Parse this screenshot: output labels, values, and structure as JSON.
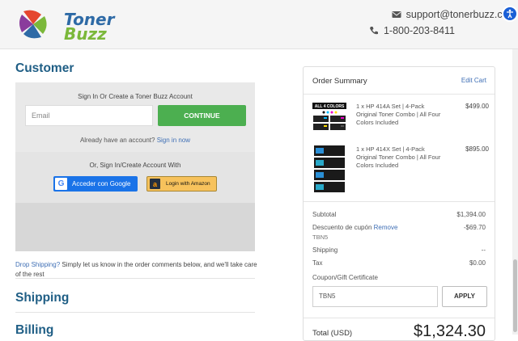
{
  "header": {
    "logo_line1": "Toner",
    "logo_line2": "Buzz",
    "email": "support@tonerbuzz.com",
    "phone": "1-800-203-8411"
  },
  "customer": {
    "heading": "Customer",
    "signin_title": "Sign In Or Create a Toner Buzz Account",
    "email_placeholder": "Email",
    "continue_label": "CONTINUE",
    "already_text": "Already have an account?",
    "signin_link": "Sign in now",
    "social_title": "Or, Sign In/Create Account With",
    "google_label": "Acceder con Google",
    "amazon_label": "Login with Amazon"
  },
  "dropship": {
    "link": "Drop Shipping?",
    "text": "Simply let us know in the order comments below, and we'll take care of the rest"
  },
  "sections": {
    "shipping": "Shipping",
    "billing": "Billing"
  },
  "summary": {
    "title": "Order Summary",
    "edit_cart": "Edit Cart",
    "items": [
      {
        "desc": "1 x HP 414A Set | 4-Pack Original Toner Combo | All Four Colors Included",
        "price": "$499.00",
        "badge": "ALL 4 COLORS"
      },
      {
        "desc": "1 x HP 414X Set | 4-Pack Original Toner Combo | All Four Colors Included",
        "price": "$895.00"
      }
    ],
    "subtotal_label": "Subtotal",
    "subtotal_val": "$1,394.00",
    "discount_label": "Descuento de cupón",
    "discount_remove": "Remove",
    "discount_code": "TBN5",
    "discount_val": "-$69.70",
    "shipping_label": "Shipping",
    "shipping_val": "--",
    "tax_label": "Tax",
    "tax_val": "$0.00",
    "coupon_label": "Coupon/Gift Certificate",
    "coupon_value": "TBN5",
    "apply_label": "APPLY",
    "total_label": "Total (USD)",
    "total_val": "$1,324.30"
  },
  "colors": {
    "brand_blue": "#1f5e85",
    "continue_green": "#4caf50",
    "link_blue": "#3f6fb5",
    "google_blue": "#1a73e8",
    "amazon_yellow": "#f7c25c"
  }
}
